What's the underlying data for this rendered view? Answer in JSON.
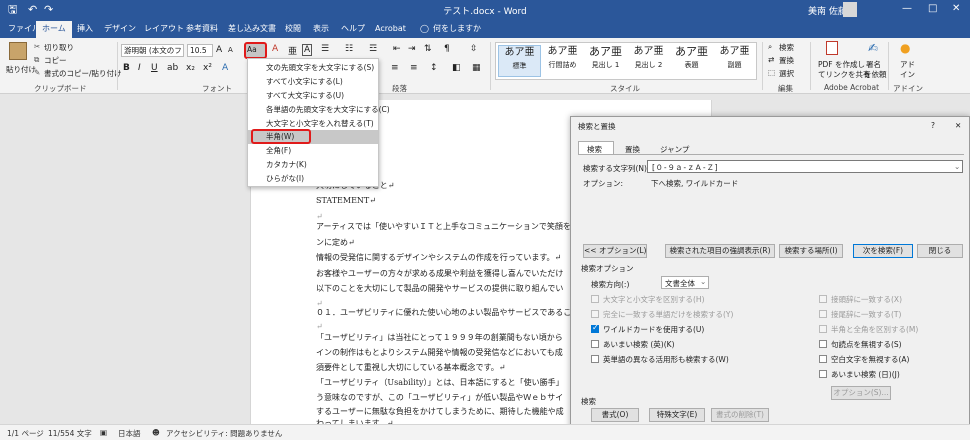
{
  "titlebar": {
    "title": "テスト.docx - Word",
    "user": "美南 佐藤",
    "undo": "↶",
    "redo": "↷",
    "save": "🖫",
    "minimize": "—",
    "maximize": "□",
    "close": "✕"
  },
  "tabs": [
    "ファイル",
    "ホーム",
    "挿入",
    "デザイン",
    "レイアウト",
    "参考資料",
    "差し込み文書",
    "校閲",
    "表示",
    "ヘルプ",
    "Acrobat"
  ],
  "tell_me": "何をしますか",
  "ribbon": {
    "paste": "貼り付け",
    "cut": "切り取り",
    "copy": "コピー",
    "format_painter": "書式のコピー/貼り付け",
    "clipboard_label": "クリップボード",
    "font_name": "游明朝 (本文のフォ",
    "font_size": "10.5",
    "font_label": "フォント",
    "paragraph_label": "段落",
    "styles": [
      {
        "sample": "あア亜",
        "label": "標準"
      },
      {
        "sample": "あア亜",
        "label": "行間詰め"
      },
      {
        "sample": "あア亜",
        "label": "見出し 1"
      },
      {
        "sample": "あア亜",
        "label": "見出し 2"
      },
      {
        "sample": "あア亜",
        "label": "表題"
      },
      {
        "sample": "あア亜",
        "label": "副題"
      }
    ],
    "styles_label": "スタイル",
    "find": "検索",
    "replace": "置換",
    "select": "選択",
    "edit_label": "編集",
    "pdf_share": "PDF を作成してリンクを共有",
    "pdf_share_1": "PDF を作成し",
    "pdf_share_2": "てリンクを共有",
    "sign_1": "署名",
    "sign_2": "を依頼",
    "acrobat_label": "Adobe Acrobat",
    "addin_1": "アド",
    "addin_2": "イン",
    "addin_label": "アドイン",
    "change_case": "Aa"
  },
  "case_menu": {
    "items": [
      "文の先頭文字を大文字にする(S)",
      "すべて小文字にする(L)",
      "すべて大文字にする(U)",
      "各単語の先頭文字を大文字にする(C)",
      "大文字と小文字を入れ替える(T)",
      "半角(W)",
      "全角(F)",
      "カタカナ(K)",
      "ひらがな(I)"
    ],
    "highlighted": "半角(W)"
  },
  "document": {
    "lines": [
      "大切にしていること↵",
      "STATEMENT↵",
      "↵",
      "アーティスでは「使いやすいＩＴと上手なコミュニケーションで笑顔を",
      "ンに定め↵",
      "情報の受発信に関するデザインやシステムの作成を行っています。↵",
      "お客様やユーザーの方々が求める成果や利益を獲得し喜んでいただけ",
      "以下のことを大切にして製品の開発やサービスの提供に取り組んでい",
      "↵",
      "０１．ユーザビリティに優れた使い心地のよい製品やサービスであるこ",
      "↵",
      "「ユーザビリティ」は当社にとって１９９９年の創業間もない頃から",
      "インの制作はもとよりシステム開発や情報の受発信などにおいても成",
      "須要件として重視し大切にしている基本概念です。↵",
      "「ユーザビリティ（Usability）」とは、日本語にすると「使い勝手」",
      "う意味なのですが、この「ユーザビリティ」が低い製品やＷｅｂサイ",
      "するユーザーに無駄な負担をかけてしまうために、期待した機能や成",
      "わってしまいます。↵"
    ]
  },
  "dialog": {
    "title": "検索と置換",
    "help": "?",
    "close": "✕",
    "tabs": [
      "検索",
      "置換",
      "ジャンプ"
    ],
    "find_label": "検索する文字列(N):",
    "find_value": "[０-９ａ-ｚＡ-Ｚ]",
    "options_label": "オプション:",
    "options_value": "下へ検索, ワイルドカード",
    "btn_less": "<< オプション(L)",
    "btn_highlight": "検索された項目の強調表示(R)",
    "btn_find_in": "検索する場所(I)",
    "btn_find_next": "次を検索(F)",
    "btn_close": "閉じる",
    "search_options_heading": "検索オプション",
    "direction_label": "検索方向(:)",
    "direction_value": "文書全体",
    "left_options": [
      {
        "label": "大文字と小文字を区別する(H)",
        "state": "disabled"
      },
      {
        "label": "完全に一致する単語だけを検索する(Y)",
        "state": "disabled"
      },
      {
        "label": "ワイルドカードを使用する(U)",
        "state": "checked"
      },
      {
        "label": "あいまい検索 (英)(K)",
        "state": "unchecked"
      },
      {
        "label": "英単語の異なる活用形も検索する(W)",
        "state": "unchecked"
      }
    ],
    "right_options": [
      {
        "label": "接頭辞に一致する(X)",
        "state": "disabled"
      },
      {
        "label": "接尾辞に一致する(T)",
        "state": "disabled"
      },
      {
        "label": "半角と全角を区別する(M)",
        "state": "disabled"
      },
      {
        "label": "句読点を無視する(S)",
        "state": "unchecked"
      },
      {
        "label": "空白文字を無視する(A)",
        "state": "unchecked"
      },
      {
        "label": "あいまい検索 (日)(J)",
        "state": "unchecked"
      }
    ],
    "btn_fuzzy_options": "オプション(S)...",
    "search_heading": "検索",
    "btn_format": "書式(O)",
    "btn_special": "特殊文字(E)",
    "btn_no_format": "書式の削除(T)"
  },
  "status": {
    "page": "1/1 ページ",
    "words": "11/554 文字",
    "language": "日本語",
    "accessibility": "アクセシビリティ: 問題ありません"
  }
}
